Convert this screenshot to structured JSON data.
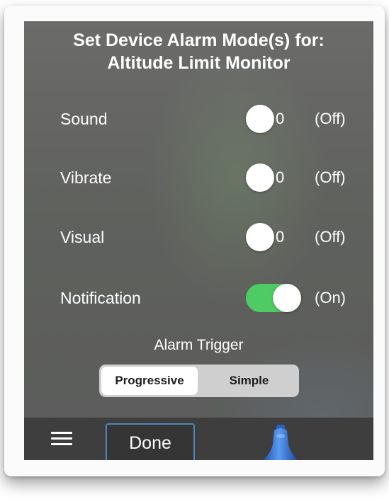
{
  "header": {
    "line1": "Set Device Alarm Mode(s) for:",
    "line2": "Altitude Limit Monitor"
  },
  "modes": [
    {
      "label": "Sound",
      "on": false,
      "off_value": "0",
      "state": "(Off)"
    },
    {
      "label": "Vibrate",
      "on": false,
      "off_value": "0",
      "state": "(Off)"
    },
    {
      "label": "Visual",
      "on": false,
      "off_value": "0",
      "state": "(Off)"
    },
    {
      "label": "Notification",
      "on": true,
      "state": "(On)"
    }
  ],
  "alarm_trigger": {
    "label": "Alarm Trigger",
    "options": [
      "Progressive",
      "Simple"
    ],
    "selected": "Progressive"
  },
  "toolbar": {
    "menu_icon": "hamburger-menu-icon",
    "done_label": "Done",
    "app_icon": "alarm-bell-icon"
  },
  "colors": {
    "toggle_on": "#4ecb62",
    "done_border": "#4f86b8",
    "bell_blue": "#2f6fd6"
  }
}
